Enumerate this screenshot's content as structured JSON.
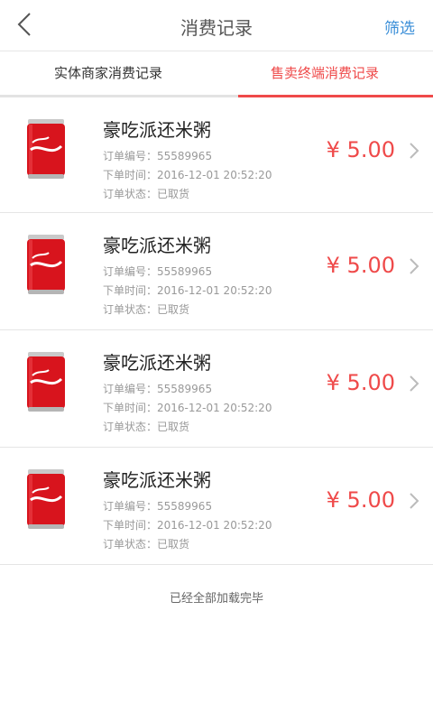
{
  "header": {
    "title": "消费记录",
    "filter_label": "筛选",
    "back_icon": "chevron-left-icon"
  },
  "tabs": [
    {
      "label": "实体商家消费记录",
      "active": false
    },
    {
      "label": "售卖终端消费记录",
      "active": true
    }
  ],
  "accent_color": "#ef4a4a",
  "link_color": "#3b8fd8",
  "orders": [
    {
      "product_name": "豪吃派还米粥",
      "order_no": "订单编号：55589965",
      "order_time": "下单时间：2016-12-01 20:52:20",
      "order_status": "订单状态：已取货",
      "price": "¥ 5.00",
      "image_icon": "coca-cola-can-icon"
    },
    {
      "product_name": "豪吃派还米粥",
      "order_no": "订单编号：55589965",
      "order_time": "下单时间：2016-12-01 20:52:20",
      "order_status": "订单状态：已取货",
      "price": "¥ 5.00",
      "image_icon": "coca-cola-can-icon"
    },
    {
      "product_name": "豪吃派还米粥",
      "order_no": "订单编号：55589965",
      "order_time": "下单时间：2016-12-01 20:52:20",
      "order_status": "订单状态：已取货",
      "price": "¥ 5.00",
      "image_icon": "coca-cola-can-icon"
    },
    {
      "product_name": "豪吃派还米粥",
      "order_no": "订单编号：55589965",
      "order_time": "下单时间：2016-12-01 20:52:20",
      "order_status": "订单状态：已取货",
      "price": "¥ 5.00",
      "image_icon": "coca-cola-can-icon"
    }
  ],
  "footer_text": "已经全部加载完毕"
}
